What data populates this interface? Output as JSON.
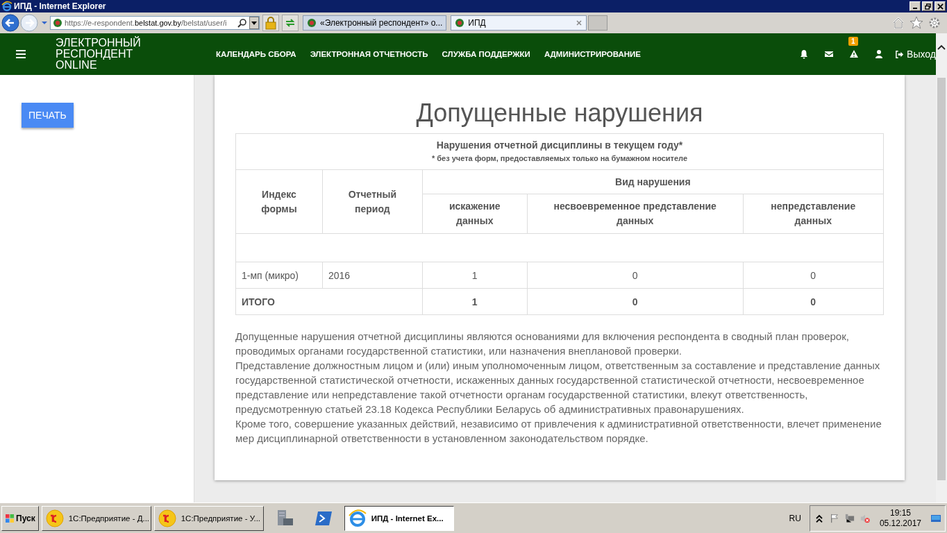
{
  "window": {
    "title": "ИПД - Internet Explorer"
  },
  "browser": {
    "address_parts": [
      {
        "text": "https://",
        "kind": "dim"
      },
      {
        "text": "e-respondent.",
        "kind": "dim"
      },
      {
        "text": "belstat.gov.by",
        "kind": "main"
      },
      {
        "text": "/belstat/user/i",
        "kind": "dim"
      }
    ],
    "tabs": [
      {
        "label": "«Электронный респондент» о...",
        "selected": false
      },
      {
        "label": "ИПД",
        "selected": true
      }
    ]
  },
  "header": {
    "logo_lines": [
      "ЭЛЕКТРОННЫЙ",
      "РЕСПОНДЕНТ",
      "ONLINE"
    ],
    "nav": [
      "КАЛЕНДАРЬ СБОРА",
      "ЭЛЕКТРОННАЯ ОТЧЕТНОСТЬ",
      "СЛУЖБА ПОДДЕРЖКИ",
      "АДМИНИСТРИРОВАНИЕ"
    ],
    "alert_badge": "1",
    "logout": "Выход"
  },
  "sidebar": {
    "print_button": "ПЕЧАТЬ"
  },
  "page": {
    "heading": "Допущенные нарушения",
    "table": {
      "caption": "Нарушения отчетной дисциплины в текущем году*",
      "note": "* без учета форм, предоставляемых только на бумажном носителе",
      "col_form": "Индекс формы",
      "col_period": "Отчетный период",
      "group_header": "Вид нарушения",
      "violation_columns": [
        "искажение данных",
        "несвоевременное представление данных",
        "непредставление данных"
      ],
      "rows": [
        {
          "form": "1-мп (микро)",
          "period": "2016",
          "values": [
            "1",
            "0",
            "0"
          ]
        }
      ],
      "total": {
        "label": "ИТОГО",
        "values": [
          "1",
          "0",
          "0"
        ]
      }
    },
    "paragraphs": [
      "Допущенные нарушения отчетной дисциплины являются основаниями для включения респондента в сводный план проверок, проводимых органами государственной статистики, или назначения внеплановой проверки.",
      "Представление должностным лицом и (или) иным уполномоченным лицом, ответственным за составление и представление данных государственной статистической отчетности, искаженных данных государственной статистической отчетности, несвоевременное представление или непредставление такой отчетности органам государственной статистики, влекут ответственность, предусмотренную статьей 23.18 Кодекса Республики Беларусь об административных правонарушениях.",
      "Кроме того, совершение указанных действий, независимо от привлечения к административной ответственности, влечет применение мер дисциплинарной ответственности в установленном законодательством порядке."
    ]
  },
  "taskbar": {
    "start": "Пуск",
    "items": [
      {
        "label": "1С:Предприятие - Д...",
        "kind": "onec",
        "selected": false
      },
      {
        "label": "1С:Предприятие - У...",
        "kind": "onec",
        "selected": false
      },
      {
        "kind": "server",
        "selected": false
      },
      {
        "kind": "shell",
        "selected": false
      },
      {
        "label": "ИПД - Internet Ex...",
        "kind": "ie",
        "selected": true
      }
    ],
    "lang": "RU",
    "time": "19:15",
    "date": "05.12.2017"
  }
}
